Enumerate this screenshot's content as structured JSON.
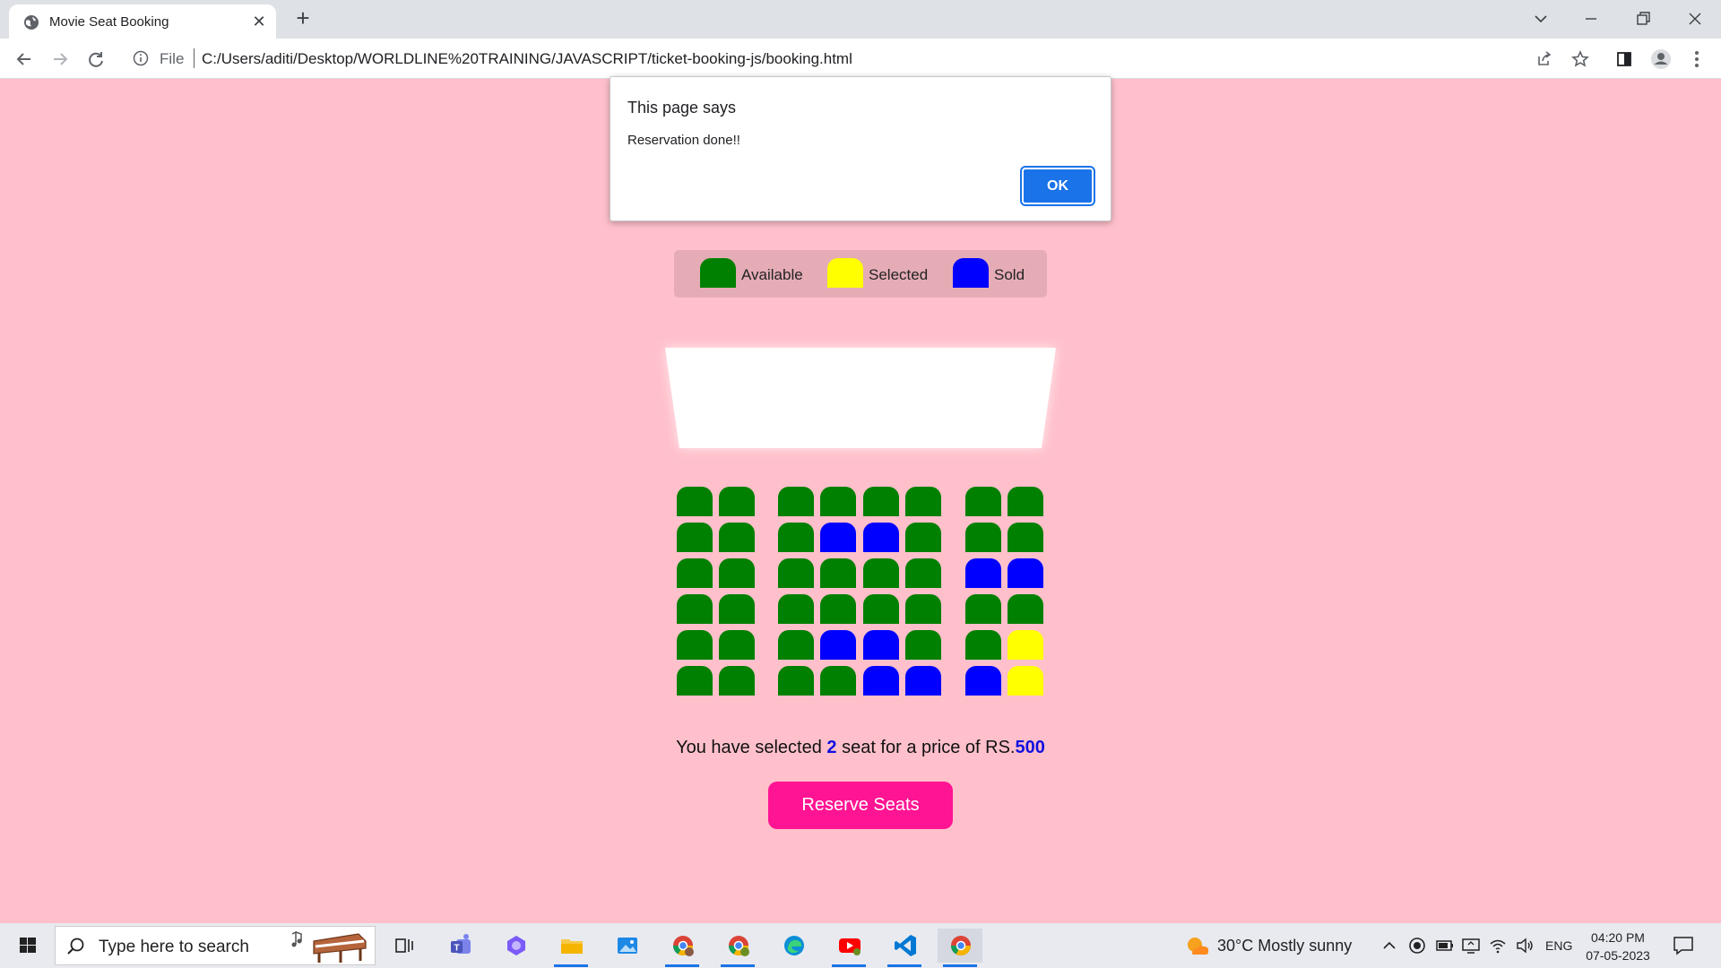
{
  "browser": {
    "tab_title": "Movie Seat Booking",
    "omnibox_scheme": "File",
    "url": "C:/Users/aditi/Desktop/WORLDLINE%20TRAINING/JAVASCRIPT/ticket-booking-js/booking.html"
  },
  "alert": {
    "title": "This page says",
    "message": "Reservation done!!",
    "ok_label": "OK"
  },
  "legend": [
    {
      "label": "Available",
      "status": "available"
    },
    {
      "label": "Selected",
      "status": "selected"
    },
    {
      "label": "Sold",
      "status": "sold"
    }
  ],
  "colors": {
    "available": "#008000",
    "selected": "#ffff00",
    "sold": "#0000ff",
    "background": "#ffc0cb",
    "reserve_button": "#ff1493",
    "highlight": "#1010e0"
  },
  "seats": [
    [
      "available",
      "available",
      "available",
      "available",
      "available",
      "available",
      "available",
      "available"
    ],
    [
      "available",
      "available",
      "available",
      "sold",
      "sold",
      "available",
      "available",
      "available"
    ],
    [
      "available",
      "available",
      "available",
      "available",
      "available",
      "available",
      "sold",
      "sold"
    ],
    [
      "available",
      "available",
      "available",
      "available",
      "available",
      "available",
      "available",
      "available"
    ],
    [
      "available",
      "available",
      "available",
      "sold",
      "sold",
      "available",
      "available",
      "selected"
    ],
    [
      "available",
      "available",
      "available",
      "available",
      "sold",
      "sold",
      "sold",
      "selected"
    ]
  ],
  "summary": {
    "prefix": "You have selected ",
    "count": "2",
    "middle": " seat for a price of RS.",
    "price": "500"
  },
  "reserve_label": "Reserve Seats",
  "taskbar": {
    "search_placeholder": "Type here to search",
    "weather": "30°C  Mostly sunny",
    "language": "ENG",
    "time": "04:20 PM",
    "date": "07-05-2023"
  }
}
